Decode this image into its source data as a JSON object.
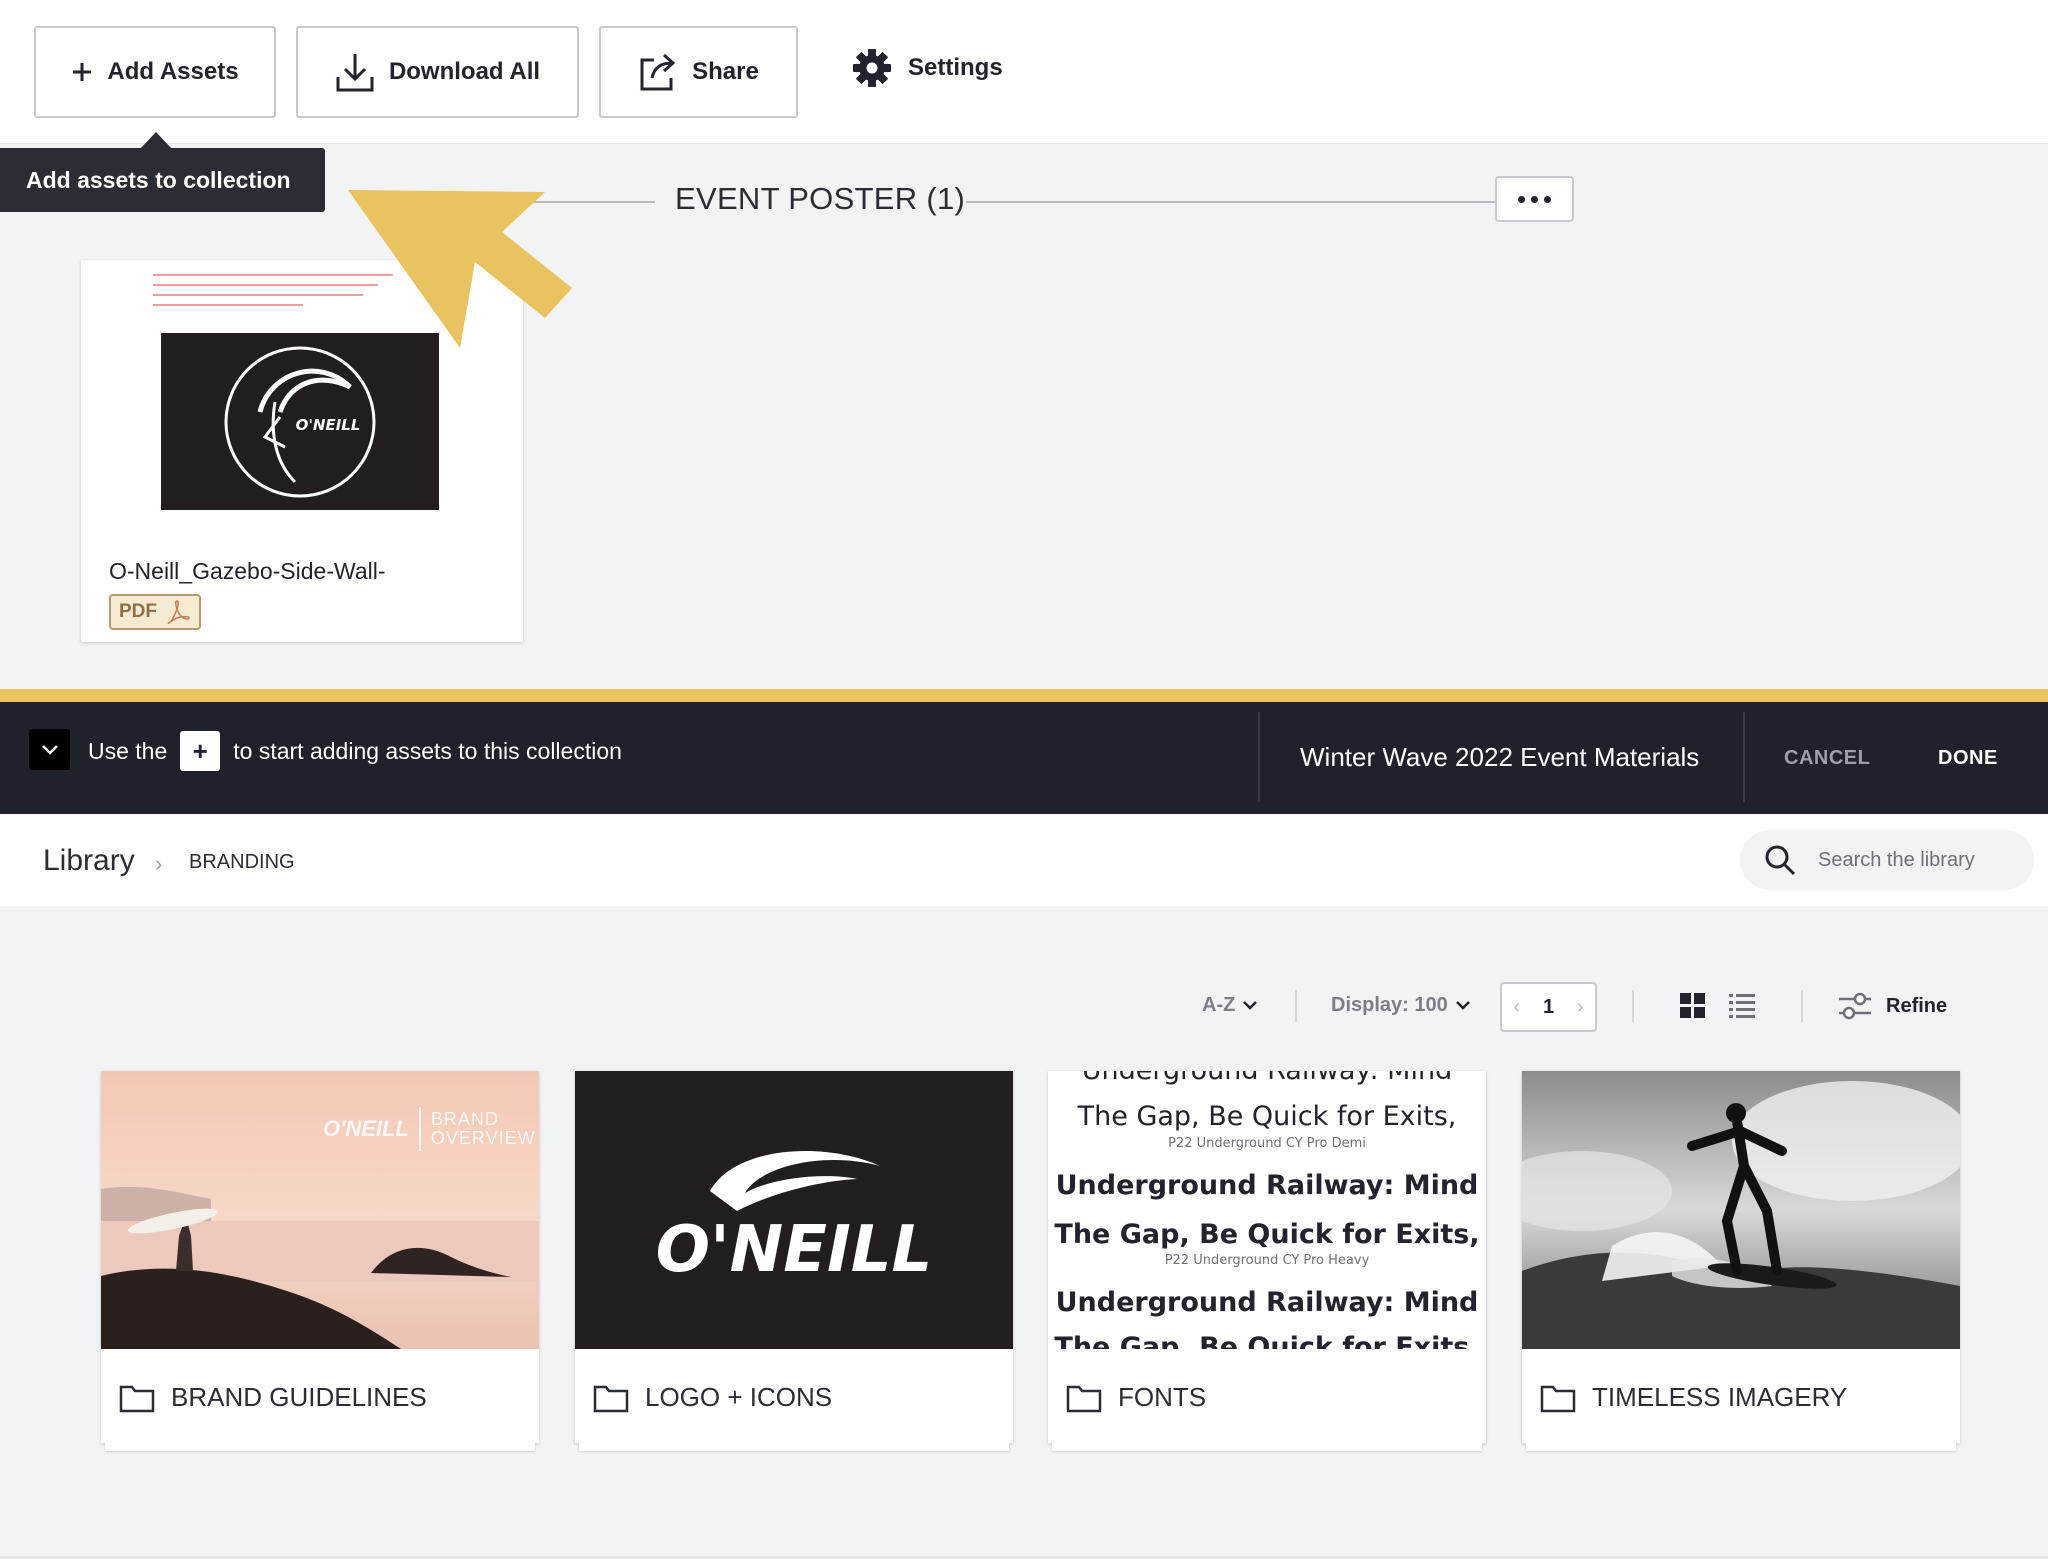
{
  "toolbar": {
    "add_assets": "Add Assets",
    "download_all": "Download All",
    "share": "Share",
    "settings": "Settings"
  },
  "tooltip": "Add assets to collection",
  "section": {
    "title": "EVENT POSTER (1)"
  },
  "asset": {
    "name": "O-Neill_Gazebo-Side-Wall-",
    "type": "PDF"
  },
  "instruction_bar": {
    "hint_before": "Use the",
    "hint_plus": "+",
    "hint_after": "to start adding assets to this collection",
    "collection_name": "Winter Wave 2022 Event Materials",
    "cancel": "CANCEL",
    "done": "DONE"
  },
  "library": {
    "breadcrumb_root": "Library",
    "breadcrumb_current": "BRANDING",
    "search_placeholder": "Search the library"
  },
  "controls": {
    "sort": "A-Z",
    "display": "Display: 100",
    "page": "1",
    "refine": "Refine"
  },
  "folders": [
    {
      "label": "BRAND GUIDELINES",
      "overlay_brand": "BRAND",
      "overlay_overview": "OVERVIEW"
    },
    {
      "label": "LOGO + ICONS",
      "logo_text": "O'NEILL"
    },
    {
      "label": "FONTS"
    },
    {
      "label": "TIMELESS IMAGERY"
    }
  ],
  "font_samples": {
    "line1": "Underground Railway: Mind",
    "line2": "The Gap, Be Quick for Exits,",
    "caption1": "P22 Underground CY Pro Demi",
    "line3": "Underground Railway: Mind",
    "line4": "The Gap, Be Quick for Exits,",
    "caption2": "P22 Underground CY Pro Heavy",
    "line5": "Underground Railway: Mind",
    "line6": "The Gap, Be Quick for Exits,"
  },
  "icons": {
    "add": "plus-icon",
    "download": "download-icon",
    "share": "share-icon",
    "settings": "gear-icon",
    "more": "ellipsis-icon",
    "search": "search-icon",
    "folder": "folder-icon",
    "grid": "grid-view-icon",
    "list": "list-view-icon",
    "refine": "sliders-icon"
  },
  "colors": {
    "accent_gold": "#e9c35f",
    "dark_bar": "#1f222b",
    "background": "#f2f3f5"
  }
}
